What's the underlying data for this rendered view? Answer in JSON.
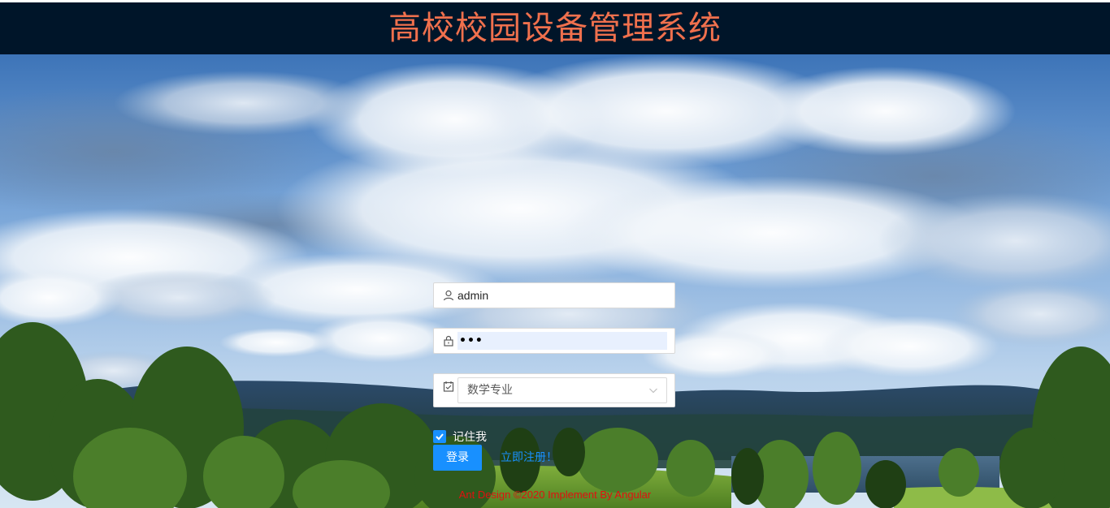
{
  "header": {
    "title": "高校校园设备管理系统"
  },
  "login": {
    "username_value": "admin",
    "password_dots": "•••",
    "major_selected": "数学专业",
    "remember_label": "记住我",
    "remember_checked": true,
    "login_button": "登录",
    "register_link": "立即注册！"
  },
  "icons": {
    "username": "user-icon",
    "password": "lock-icon",
    "major": "calendar-check-icon",
    "select_arrow": "chevron-down-icon",
    "checkbox": "check-icon"
  },
  "footer": {
    "text": "Ant Design ©2020 Implement By Angular"
  },
  "colors": {
    "header_bg": "#001529",
    "title": "#f0704d",
    "primary": "#1890ff",
    "footer_text": "#e01010"
  }
}
